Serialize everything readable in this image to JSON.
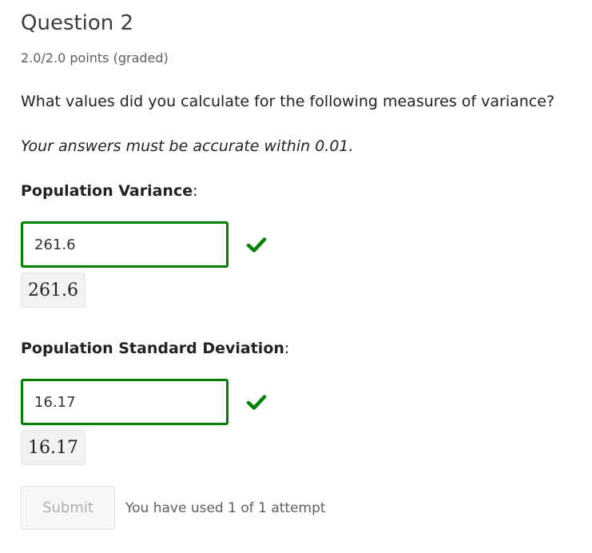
{
  "question": {
    "title": "Question 2",
    "points": "2.0/2.0 points (graded)",
    "prompt": "What values did you calculate for the following measures of variance?",
    "note": "Your answers must be accurate within 0.01."
  },
  "fields": [
    {
      "label_bold": "Population Variance",
      "label_suffix": ":",
      "value": "261.6",
      "preview": "261.6",
      "status": "correct"
    },
    {
      "label_bold": "Population Standard Deviation",
      "label_suffix": ":",
      "value": "16.17",
      "preview": "16.17",
      "status": "correct"
    }
  ],
  "actions": {
    "submit_label": "Submit",
    "attempts_text": "You have used 1 of 1 attempt"
  },
  "colors": {
    "correct": "#008100",
    "submit_disabled_text": "#b0b0b0"
  },
  "icons": {
    "status": "checkmark-icon"
  }
}
